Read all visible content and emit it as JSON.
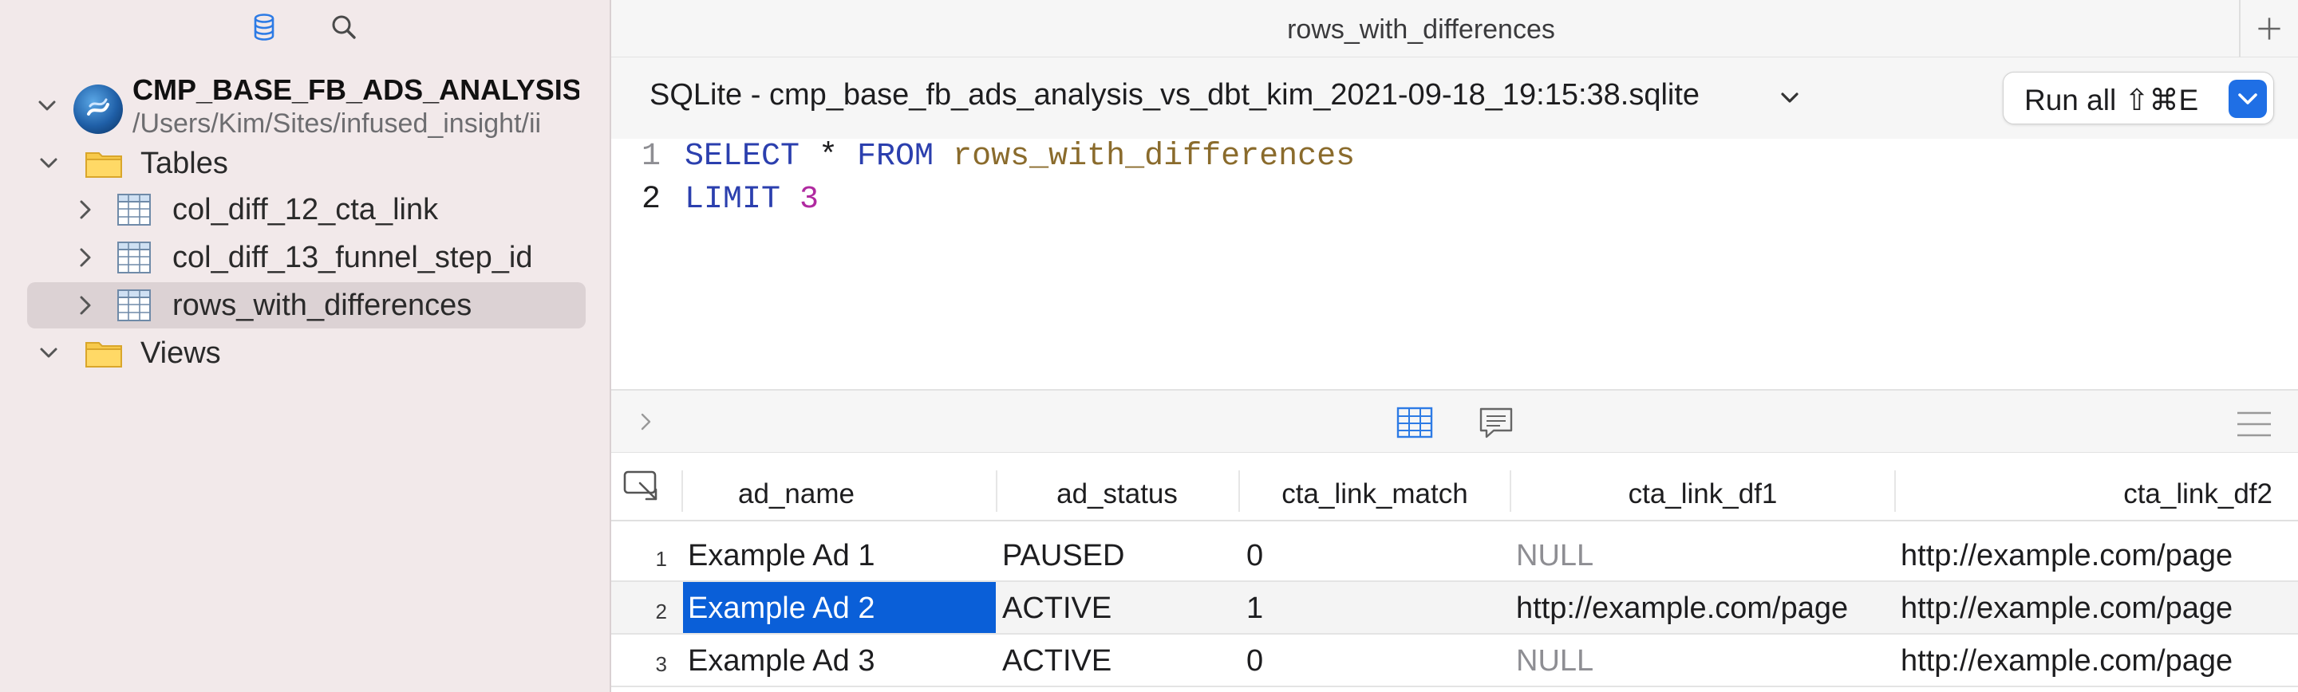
{
  "sidebar": {
    "connection": {
      "name": "CMP_BASE_FB_ADS_ANALYSIS_",
      "path": "/Users/Kim/Sites/infused_insight/ii"
    },
    "tables_label": "Tables",
    "views_label": "Views",
    "tables": [
      {
        "label": "col_diff_12_cta_link"
      },
      {
        "label": "col_diff_13_funnel_step_id"
      },
      {
        "label": "rows_with_differences",
        "selected": true
      }
    ]
  },
  "titlebar": {
    "title": "rows_with_differences"
  },
  "toolbar": {
    "connection_label": "SQLite - cmp_base_fb_ads_analysis_vs_dbt_kim_2021-09-18_19:15:38.sqlite",
    "run_label": "Run all ⇧⌘E"
  },
  "editor": {
    "lines": [
      {
        "number": "1",
        "kw1": "SELECT",
        "op": " * ",
        "kw2": "FROM",
        "table": " rows_with_differences"
      },
      {
        "number": "2",
        "kw1": "LIMIT",
        "num": " 3"
      }
    ]
  },
  "results": {
    "columns": [
      "ad_name",
      "ad_status",
      "cta_link_match",
      "cta_link_df1",
      "cta_link_df2"
    ],
    "rows": [
      {
        "n": "1",
        "cells": [
          "Example Ad 1",
          "PAUSED",
          "0",
          "NULL",
          "http://example.com/page"
        ]
      },
      {
        "n": "2",
        "cells": [
          "Example Ad 2",
          "ACTIVE",
          "1",
          "http://example.com/page",
          "http://example.com/page"
        ]
      },
      {
        "n": "3",
        "cells": [
          "Example Ad 3",
          "ACTIVE",
          "0",
          "NULL",
          "http://example.com/page"
        ]
      }
    ]
  },
  "colors": {
    "sidebar_bg": "#f2e9ea",
    "accent": "#1f6fe5",
    "selected_cell": "#0a5fd8",
    "keyword": "#2b3fae",
    "table_name": "#8a6b2c",
    "number_literal": "#b02aa0"
  },
  "icons": {
    "sidebar_toolbar": [
      "database-icon",
      "search-icon"
    ],
    "results_bar": [
      "chevron-right-icon",
      "grid-view-icon",
      "text-view-icon",
      "list-menu-icon"
    ]
  }
}
